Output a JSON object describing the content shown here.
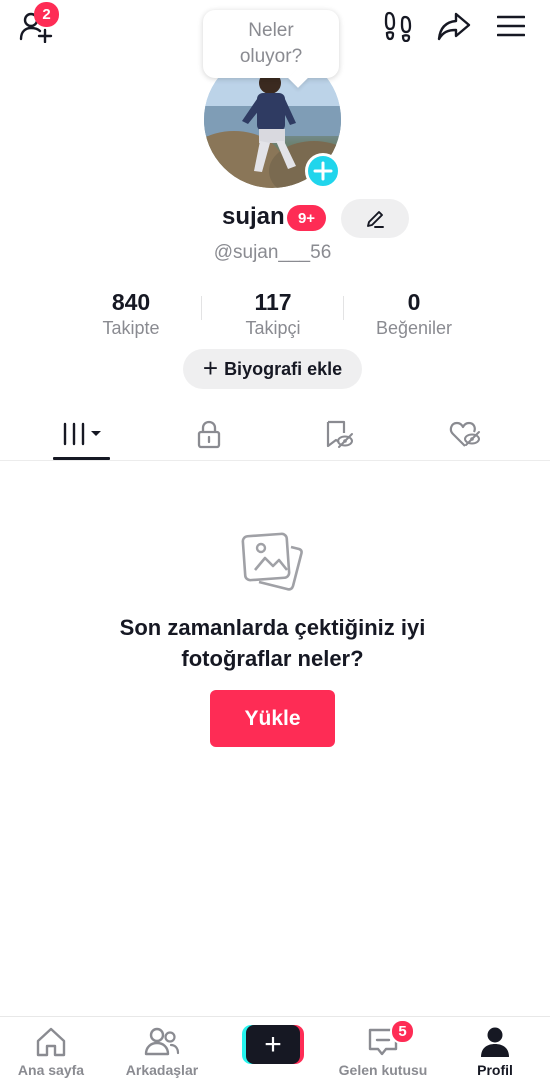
{
  "top_bar": {
    "add_friends_badge": "2"
  },
  "status_bubble": {
    "line1": "Neler",
    "line2": "oluyor?"
  },
  "profile": {
    "display_name": "sujan",
    "name_badge": "9+",
    "handle": "@sujan___56"
  },
  "stats": [
    {
      "value": "840",
      "label": "Takipte"
    },
    {
      "value": "117",
      "label": "Takipçi"
    },
    {
      "value": "0",
      "label": "Beğeniler"
    }
  ],
  "bio_button": {
    "plus": "+",
    "label": "Biyografi ekle"
  },
  "empty_state": {
    "line1": "Son zamanlarda çektiğiniz iyi",
    "line2": "fotoğraflar neler?",
    "button": "Yükle"
  },
  "bottom_nav": {
    "home": "Ana sayfa",
    "friends": "Arkadaşlar",
    "create": "+",
    "inbox": "Gelen kutusu",
    "inbox_badge": "5",
    "profile": "Profil"
  },
  "colors": {
    "accent": "#fe2c55",
    "cyan": "#20d5ec",
    "text": "#161823",
    "muted": "#8a8b91"
  }
}
